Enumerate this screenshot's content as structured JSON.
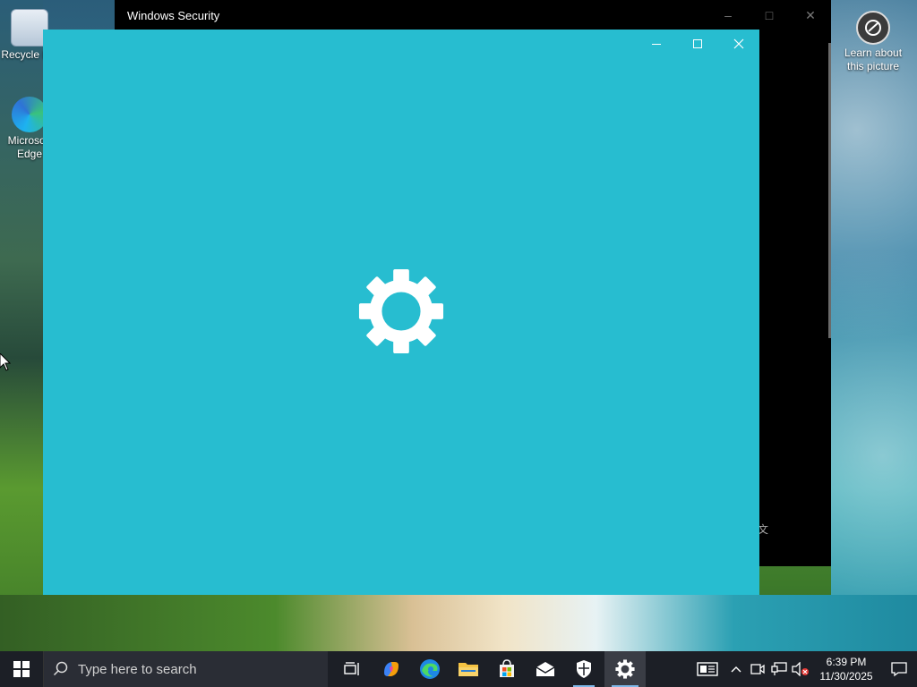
{
  "desktop": {
    "icons": [
      {
        "label": "Recycle Bin",
        "icon": "recycle-bin-icon"
      },
      {
        "label": "Microsoft Edge",
        "icon": "edge-icon"
      }
    ],
    "learn_about_picture": "Learn about this picture"
  },
  "background_window": {
    "title": "Windows Security",
    "glimpse_text": "文"
  },
  "foreground_window": {
    "icon": "gear-icon",
    "accent_color": "#27bdd0"
  },
  "taskbar": {
    "search_placeholder": "Type here to search",
    "apps": [
      {
        "name": "task-view",
        "icon": "task-view-icon"
      },
      {
        "name": "copilot",
        "icon": "copilot-icon"
      },
      {
        "name": "edge",
        "icon": "edge-icon"
      },
      {
        "name": "file-explorer",
        "icon": "folder-icon"
      },
      {
        "name": "store",
        "icon": "store-icon"
      },
      {
        "name": "mail",
        "icon": "mail-icon"
      },
      {
        "name": "windows-security",
        "icon": "shield-icon"
      },
      {
        "name": "settings",
        "icon": "gear-icon"
      }
    ],
    "tray": {
      "time": "6:39 PM",
      "date": "11/30/2025"
    }
  }
}
